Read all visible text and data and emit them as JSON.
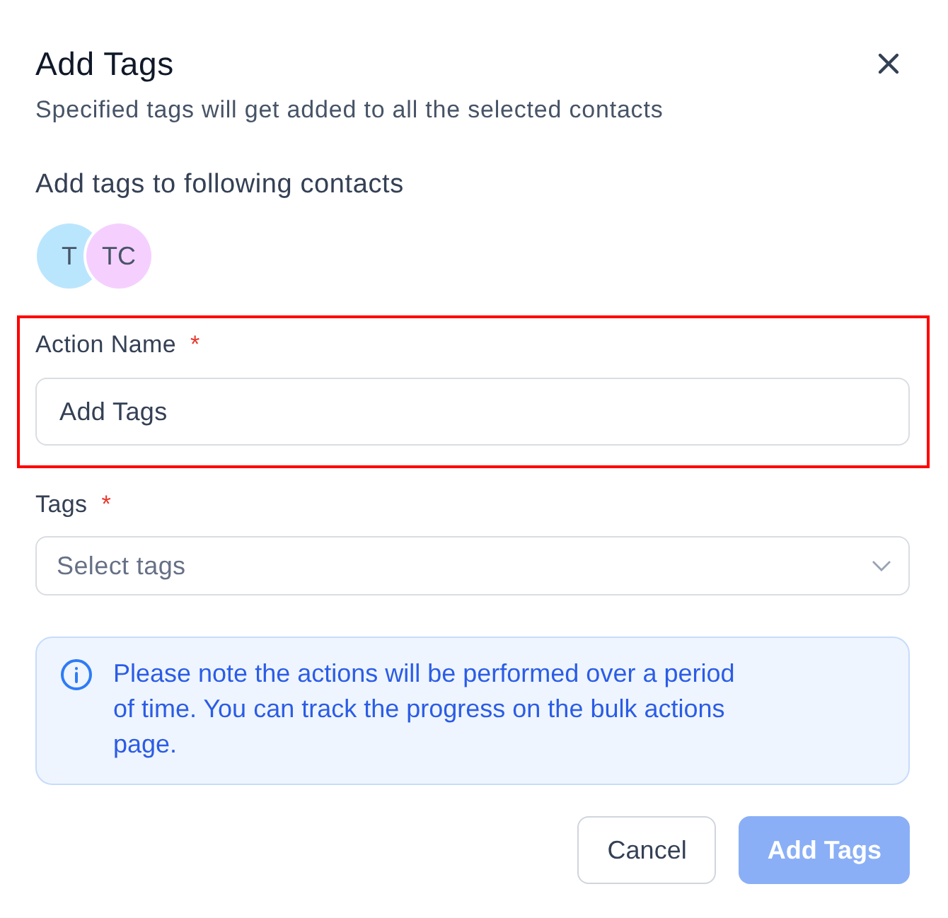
{
  "dialog": {
    "title": "Add Tags",
    "subtitle": "Specified tags will get added to all the selected contacts"
  },
  "contacts": {
    "heading": "Add tags to following contacts",
    "avatars": [
      {
        "initials": "T",
        "color": "#bae6fd"
      },
      {
        "initials": "TC",
        "color": "#f5d0fe"
      }
    ]
  },
  "fields": [
    {
      "kind": "text",
      "label": "Action Name",
      "required_mark": "*",
      "value": "Add Tags",
      "highlighted": true
    },
    {
      "kind": "select",
      "label": "Tags",
      "required_mark": "*",
      "placeholder": "Select tags",
      "highlighted": false
    }
  ],
  "notice": {
    "text": "Please note the actions will be performed over a period of time. You can track the progress on the bulk actions page."
  },
  "buttons": [
    {
      "label": "Cancel",
      "kind": "secondary",
      "disabled": false
    },
    {
      "label": "Add Tags",
      "kind": "primary",
      "disabled": true
    }
  ]
}
